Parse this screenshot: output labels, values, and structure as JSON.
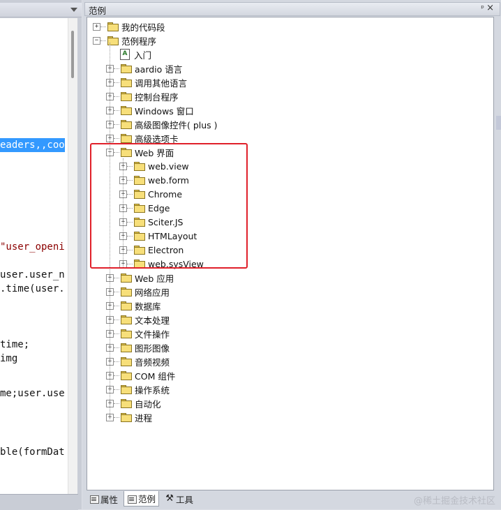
{
  "editor": {
    "code_lines": [
      {
        "text": "eaders,,coo",
        "selected": true
      },
      {
        "text": "\"user_openi",
        "string": true
      },
      {
        "text": "user.user_n"
      },
      {
        "text": ".time(user."
      },
      {
        "text": "time;"
      },
      {
        "text": "img"
      },
      {
        "text": "me;user.use"
      },
      {
        "text": "ble(formDat"
      }
    ]
  },
  "panel": {
    "title": "范例",
    "pin_glyph": "ᵖ",
    "close_glyph": "×"
  },
  "tree": {
    "nodes": [
      {
        "label": "我的代码段",
        "level": 0,
        "type": "folder",
        "expander": "+"
      },
      {
        "label": "范例程序",
        "level": 0,
        "type": "folder",
        "expander": "−"
      },
      {
        "label": "入门",
        "level": 1,
        "type": "doc",
        "expander": ""
      },
      {
        "label": "aardio 语言",
        "level": 1,
        "type": "folder",
        "expander": "+"
      },
      {
        "label": "调用其他语言",
        "level": 1,
        "type": "folder",
        "expander": "+"
      },
      {
        "label": "控制台程序",
        "level": 1,
        "type": "folder",
        "expander": "+"
      },
      {
        "label": "Windows 窗口",
        "level": 1,
        "type": "folder",
        "expander": "+"
      },
      {
        "label": "高级图像控件( plus )",
        "level": 1,
        "type": "folder",
        "expander": "+"
      },
      {
        "label": "高级选项卡",
        "level": 1,
        "type": "folder",
        "expander": "+"
      },
      {
        "label": "Web 界面",
        "level": 1,
        "type": "folder",
        "expander": "−"
      },
      {
        "label": "web.view",
        "level": 2,
        "type": "folder",
        "expander": "+"
      },
      {
        "label": "web.form",
        "level": 2,
        "type": "folder",
        "expander": "+"
      },
      {
        "label": "Chrome",
        "level": 2,
        "type": "folder",
        "expander": "+"
      },
      {
        "label": "Edge",
        "level": 2,
        "type": "folder",
        "expander": "+"
      },
      {
        "label": "Sciter.JS",
        "level": 2,
        "type": "folder",
        "expander": "+"
      },
      {
        "label": "HTMLayout",
        "level": 2,
        "type": "folder",
        "expander": "+"
      },
      {
        "label": "Electron",
        "level": 2,
        "type": "folder",
        "expander": "+"
      },
      {
        "label": "web.sysView",
        "level": 2,
        "type": "folder",
        "expander": "+"
      },
      {
        "label": "Web 应用",
        "level": 1,
        "type": "folder",
        "expander": "+"
      },
      {
        "label": "网络应用",
        "level": 1,
        "type": "folder",
        "expander": "+"
      },
      {
        "label": "数据库",
        "level": 1,
        "type": "folder",
        "expander": "+"
      },
      {
        "label": "文本处理",
        "level": 1,
        "type": "folder",
        "expander": "+"
      },
      {
        "label": "文件操作",
        "level": 1,
        "type": "folder",
        "expander": "+"
      },
      {
        "label": "图形图像",
        "level": 1,
        "type": "folder",
        "expander": "+"
      },
      {
        "label": "音频视频",
        "level": 1,
        "type": "folder",
        "expander": "+"
      },
      {
        "label": "COM 组件",
        "level": 1,
        "type": "folder",
        "expander": "+"
      },
      {
        "label": "操作系统",
        "level": 1,
        "type": "folder",
        "expander": "+"
      },
      {
        "label": "自动化",
        "level": 1,
        "type": "folder",
        "expander": "+"
      },
      {
        "label": "进程",
        "level": 1,
        "type": "folder",
        "expander": "+"
      }
    ]
  },
  "tabs": [
    {
      "label": "属性",
      "icon": "properties-icon",
      "active": false
    },
    {
      "label": "范例",
      "icon": "samples-icon",
      "active": true
    },
    {
      "label": "工具",
      "icon": "tools-icon",
      "active": false
    }
  ],
  "watermark": "@稀土掘金技术社区",
  "colors": {
    "selection": "#3399ff",
    "highlight_box": "#e0202a",
    "folder": "#f7df7a"
  }
}
